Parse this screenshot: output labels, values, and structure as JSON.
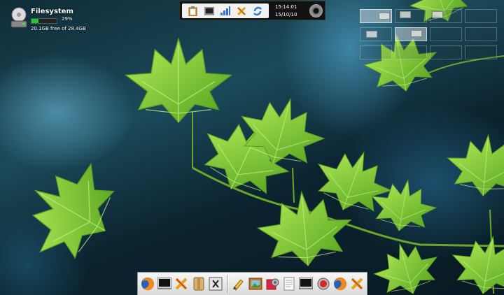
{
  "filesystem": {
    "title": "Filesystem",
    "percent": "29%",
    "usage_fraction": 0.29,
    "free_text": "20.1GB free of 28.4GB"
  },
  "top_panel": {
    "time": "15:14:01",
    "date": "15/10/10",
    "launchers": [
      "clipboard-icon",
      "terminal-icon",
      "signal-bars-icon",
      "tools-icon",
      "refresh-icon"
    ]
  },
  "dock": {
    "icons": [
      "firefox-icon",
      "terminal-icon",
      "tools-icon",
      "archive-icon",
      "x-terminal-icon",
      "pen-icon",
      "image-viewer-icon",
      "settings-icon",
      "text-editor-icon",
      "terminal-icon",
      "record-icon",
      "firefox-icon",
      "tools-icon"
    ]
  },
  "colors": {
    "usage_bar": "#22c733",
    "panel_bg": "#121212",
    "leaf": "#8fd43a"
  }
}
